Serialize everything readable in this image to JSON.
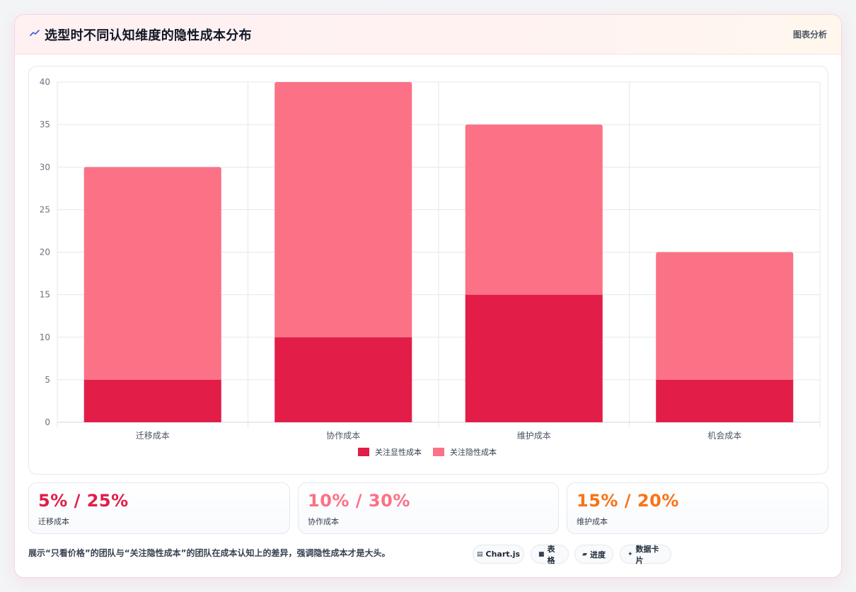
{
  "header": {
    "title": "选型时不同认知维度的隐性成本分布",
    "tag": "图表分析"
  },
  "chart_data": {
    "type": "bar",
    "stacked": true,
    "categories": [
      "迁移成本",
      "协作成本",
      "维护成本",
      "机会成本"
    ],
    "series": [
      {
        "name": "关注显性成本",
        "values": [
          5,
          10,
          15,
          5
        ],
        "color": "#e11d48"
      },
      {
        "name": "关注隐性成本",
        "values": [
          25,
          30,
          20,
          15
        ],
        "color": "#fb7185"
      }
    ],
    "ylim": [
      0,
      40
    ],
    "yticks": [
      0,
      5,
      10,
      15,
      20,
      25,
      30,
      35,
      40
    ],
    "grid": true,
    "legend": "bottom"
  },
  "stats": [
    {
      "value": "5% / 25%",
      "label": "迁移成本",
      "color": "#e11d48"
    },
    {
      "value": "10% / 30%",
      "label": "协作成本",
      "color": "#fb7185"
    },
    {
      "value": "15% / 20%",
      "label": "维护成本",
      "color": "#f97316"
    }
  ],
  "footer": {
    "description": "展示“只看价格”的团队与“关注隐性成本”的团队在成本认知上的差异，强调隐性成本才是大头。",
    "pills": [
      {
        "icon": "▤",
        "label": "Chart.js"
      },
      {
        "icon": "■",
        "label": "表格"
      },
      {
        "icon": "▰",
        "label": "进度"
      },
      {
        "icon": "✦",
        "label": "数据卡片"
      }
    ]
  }
}
